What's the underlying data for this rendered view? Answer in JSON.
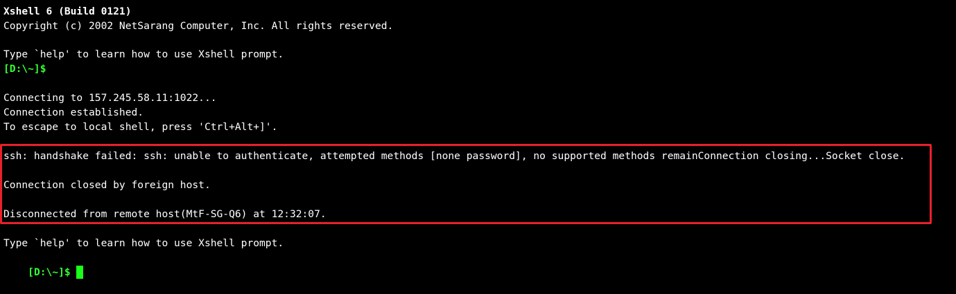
{
  "terminal": {
    "title_line": "Xshell 6 (Build 0121)",
    "copyright_line": "Copyright (c) 2002 NetSarang Computer, Inc. All rights reserved.",
    "help_line_1": "Type `help' to learn how to use Xshell prompt.",
    "prompt_1": "[D:\\~]$",
    "connecting_line": "Connecting to 157.245.58.11:1022...",
    "established_line": "Connection established.",
    "escape_line": "To escape to local shell, press 'Ctrl+Alt+]'.",
    "error_line": "ssh: handshake failed: ssh: unable to authenticate, attempted methods [none password], no supported methods remainConnection closing...Socket close.",
    "closed_line": "Connection closed by foreign host.",
    "disconnected_line": "Disconnected from remote host(MtF-SG-Q6) at 12:32:07.",
    "help_line_2": "Type `help' to learn how to use Xshell prompt.",
    "prompt_2": "[D:\\~]$"
  },
  "colors": {
    "background": "#000000",
    "text": "#ffffff",
    "prompt": "#33ff33",
    "cursor": "#1aff1a",
    "highlight_border": "#e8202a"
  }
}
